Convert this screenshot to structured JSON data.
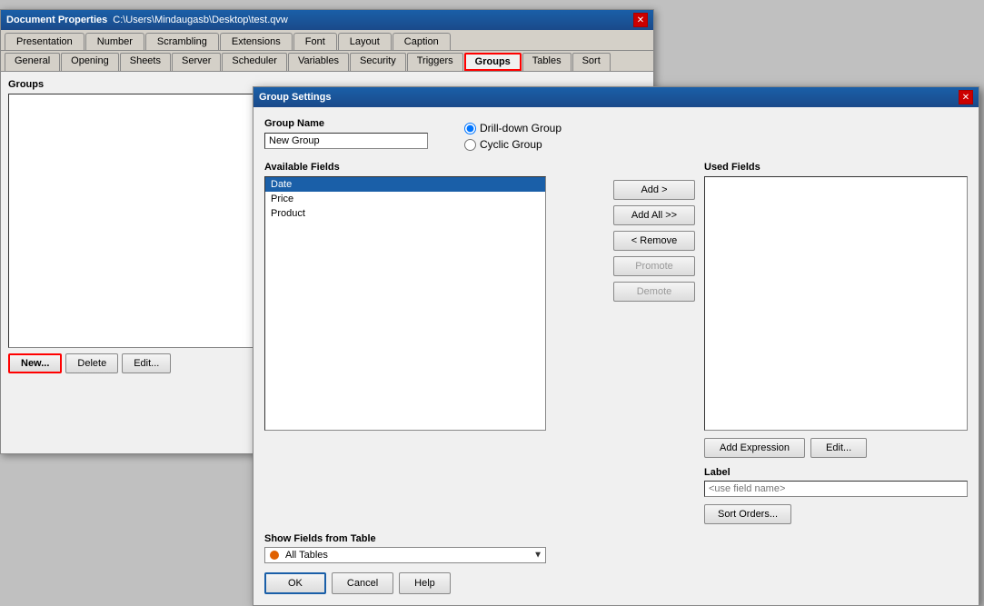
{
  "docWindow": {
    "title": "Document Properties",
    "path": "C:\\Users\\Mindaugasb\\Desktop\\test.qvw",
    "tabs1": [
      {
        "label": "Presentation",
        "active": false
      },
      {
        "label": "Number",
        "active": false
      },
      {
        "label": "Scrambling",
        "active": false
      },
      {
        "label": "Extensions",
        "active": false
      },
      {
        "label": "Font",
        "active": false
      },
      {
        "label": "Layout",
        "active": false
      },
      {
        "label": "Caption",
        "active": false
      }
    ],
    "tabs2": [
      {
        "label": "General",
        "active": false
      },
      {
        "label": "Opening",
        "active": false
      },
      {
        "label": "Sheets",
        "active": false
      },
      {
        "label": "Server",
        "active": false
      },
      {
        "label": "Scheduler",
        "active": false
      },
      {
        "label": "Variables",
        "active": false
      },
      {
        "label": "Security",
        "active": false
      },
      {
        "label": "Triggers",
        "active": false
      },
      {
        "label": "Groups",
        "active": true
      },
      {
        "label": "Tables",
        "active": false
      },
      {
        "label": "Sort",
        "active": false
      }
    ]
  },
  "groupsPanel": {
    "label": "Groups",
    "buttons": {
      "new": "New...",
      "delete": "Delete",
      "edit": "Edit..."
    }
  },
  "usedFieldsHeader": "Used Fields",
  "groupSettingsDialog": {
    "title": "Group Settings",
    "groupNameLabel": "Group Name",
    "groupNameValue": "New Group",
    "radioOptions": [
      {
        "label": "Drill-down Group",
        "checked": true
      },
      {
        "label": "Cyclic Group",
        "checked": false
      }
    ],
    "availableFieldsLabel": "Available Fields",
    "fields": [
      {
        "name": "Date",
        "selected": true
      },
      {
        "name": "Price",
        "selected": false
      },
      {
        "name": "Product",
        "selected": false
      }
    ],
    "actionButtons": {
      "add": "Add >",
      "addAll": "Add All >>",
      "remove": "< Remove",
      "promote": "Promote",
      "demote": "Demote"
    },
    "usedFieldsLabel": "Used Fields",
    "addExpressionLabel": "Add Expression",
    "editLabel": "Edit...",
    "labelSectionLabel": "Label",
    "labelPlaceholder": "<use field name>",
    "sortOrdersLabel": "Sort Orders...",
    "showFieldsLabel": "Show Fields from Table",
    "showFieldsValue": "All Tables",
    "okLabel": "OK",
    "cancelLabel": "Cancel",
    "helpLabel": "Help"
  }
}
